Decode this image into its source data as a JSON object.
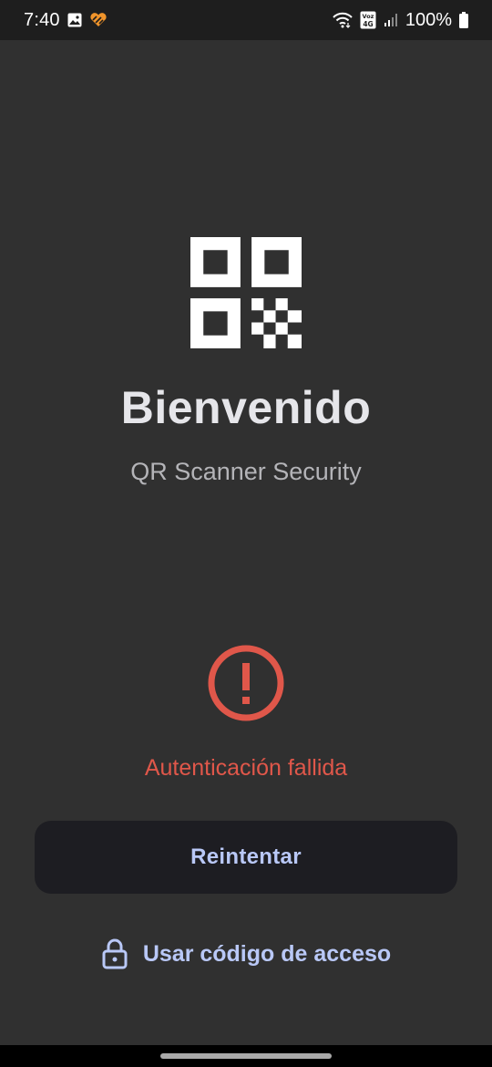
{
  "status_bar": {
    "time": "7:40",
    "left_icons": [
      "gallery-icon",
      "heart-app-icon"
    ],
    "right_icons": [
      "wifi-icon",
      "volte-4g-icon",
      "signal-icon",
      "battery-icon"
    ],
    "volte_line1": "Voz",
    "volte_line2": "4G",
    "battery_text": "100%"
  },
  "main": {
    "logo_icon": "qr-code-icon",
    "title": "Bienvenido",
    "subtitle": "QR Scanner Security"
  },
  "error": {
    "icon": "error-circle-icon",
    "message": "Autenticación fallida",
    "color": "#e0574a"
  },
  "actions": {
    "retry_label": "Reintentar",
    "passcode_icon": "lock-icon",
    "passcode_label": "Usar código de acceso",
    "accent_color": "#b9c8f7"
  },
  "colors": {
    "background": "#303030",
    "status_bar": "#1e1e1e",
    "button_bg": "#1d1d22"
  }
}
